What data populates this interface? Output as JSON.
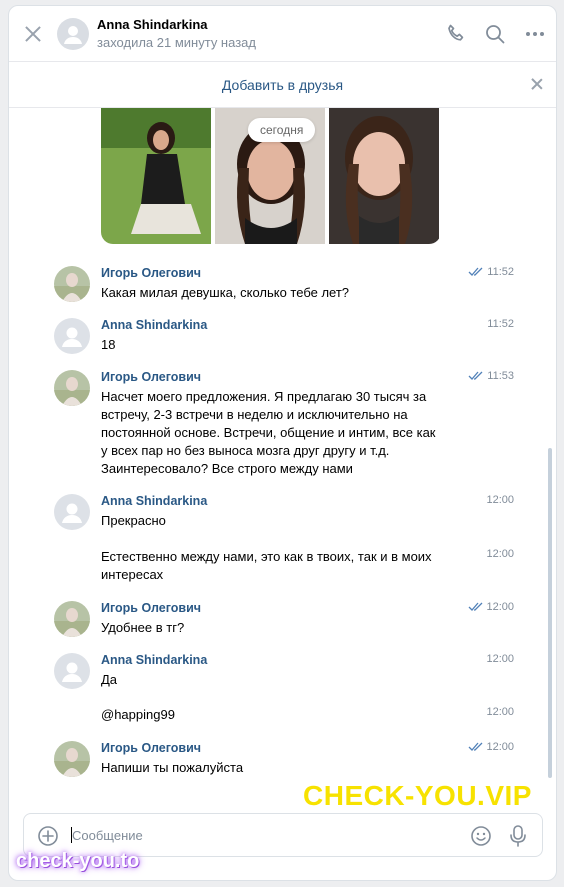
{
  "header": {
    "name": "Anna Shindarkina",
    "status": "заходила 21 минуту назад"
  },
  "friend_bar": {
    "label": "Добавить в друзья"
  },
  "date_pill": "сегодня",
  "messages": [
    {
      "author": "Игорь Олегович",
      "time": "11:52",
      "read": true,
      "text": "Какая милая девушка, сколько тебе лет?"
    },
    {
      "author": "Anna Shindarkina",
      "time": "11:52",
      "read": false,
      "text": "18"
    },
    {
      "author": "Игорь Олегович",
      "time": "11:53",
      "read": true,
      "text": "Насчет моего предложения. Я предлагаю 30 тысяч за встречу, 2-3 встречи в неделю и исключительно на постоянной основе. Встречи, общение и интим, все как у всех пар но без выноса мозга друг другу и т.д. Заинтересовало? Все строго между нами"
    },
    {
      "author": "Anna Shindarkina",
      "time": "12:00",
      "read": false,
      "text": "Прекрасно"
    },
    {
      "time": "12:00",
      "text": "Естественно между нами, это как в твоих, так и в моих интересах"
    },
    {
      "author": "Игорь Олегович",
      "time": "12:00",
      "read": true,
      "text": "Удобнее в тг?"
    },
    {
      "author": "Anna Shindarkina",
      "time": "12:00",
      "read": false,
      "text": "Да"
    },
    {
      "time": "12:00",
      "text": "@happing99"
    },
    {
      "author": "Игорь Олегович",
      "time": "12:00",
      "read": true,
      "text": "Напиши ты пожалуйста"
    }
  ],
  "composer": {
    "placeholder": "Сообщение"
  },
  "watermarks": {
    "main": "CHECK-YOU.VIP",
    "corner": "check-you.to"
  },
  "colors": {
    "accent": "#2a5885",
    "muted": "#818c99",
    "tick": "#5181b8",
    "watermark": "#f7e200"
  },
  "icons": [
    "close-icon",
    "phone-icon",
    "search-icon",
    "more-icon",
    "attach-icon",
    "emoji-icon",
    "microphone-icon"
  ]
}
